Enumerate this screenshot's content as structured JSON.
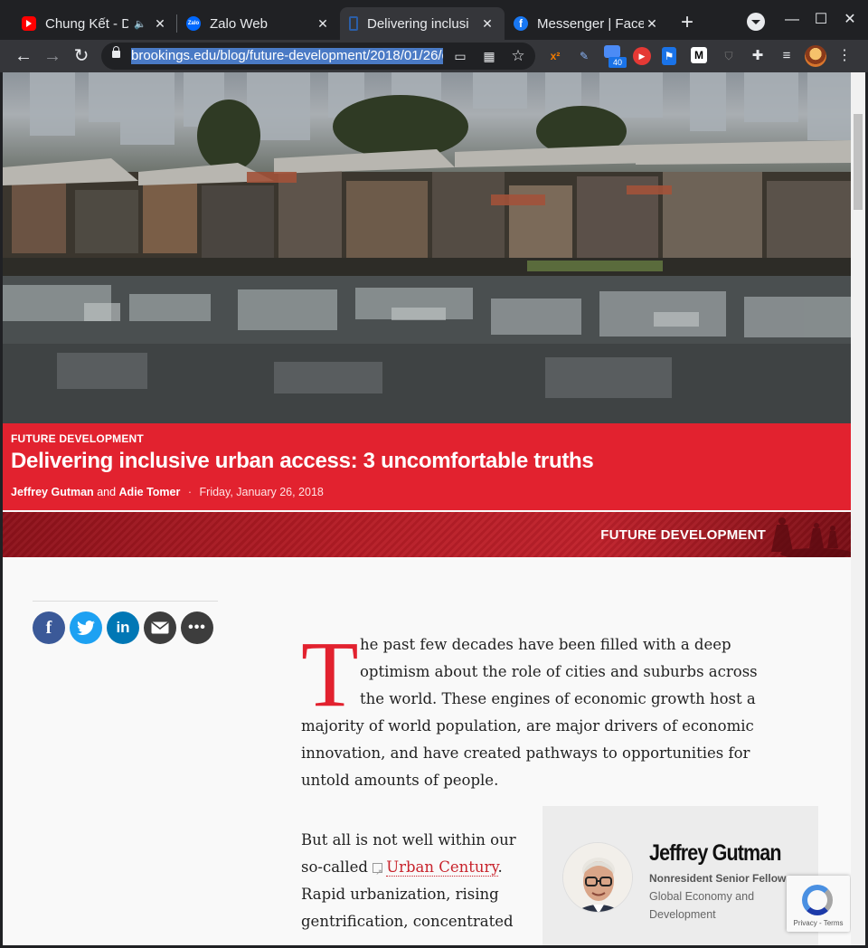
{
  "browser": {
    "tabs": [
      {
        "title": "Chung Kết - D",
        "favicon": "youtube-icon",
        "audio": true
      },
      {
        "title": "Zalo Web",
        "favicon": "zalo-icon"
      },
      {
        "title": "Delivering inclusi",
        "favicon": "brookings-icon",
        "active": true
      },
      {
        "title": "Messenger | Face",
        "favicon": "facebook-icon"
      }
    ],
    "url": "brookings.edu/blog/future-development/2018/01/26/d",
    "extension_badge": "40",
    "extensions": [
      "x²",
      "✎",
      "▶",
      "M"
    ]
  },
  "article": {
    "kicker": "FUTURE DEVELOPMENT",
    "headline": "Delivering inclusive urban access: 3 uncomfortable truths",
    "author1": "Jeffrey Gutman",
    "and": "and",
    "author2": "Adie Tomer",
    "separator": "·",
    "date": "Friday, January 26, 2018",
    "banner_label": "FUTURE DEVELOPMENT",
    "dropcap": "T",
    "p1_lines": [
      "he past few decades have been filled with a deep",
      "optimism about the role of cities and suburbs across",
      "the world. These engines of economic growth host a",
      "majority of world population, are major drivers of economic",
      "innovation, and have created pathways to opportunities for",
      "untold amounts of people."
    ],
    "p2_line1": "But all is not well within our",
    "p2_line2_pre": "so-called ",
    "p2_link": "Urban Century",
    "p2_line2_post": ".",
    "p2_line3": "Rapid urbanization, rising",
    "p2_line4": "gentrification, concentrated"
  },
  "share": {
    "facebook": "f",
    "linkedin": "in",
    "more": "•••"
  },
  "author_card": {
    "name": "Jeffrey Gutman",
    "role": "Nonresident Senior Fellow",
    "dept": "Global Economy and Development"
  },
  "recaptcha": {
    "text": "Privacy - Terms"
  },
  "colors": {
    "brand_red": "#e2222f",
    "link_red": "#c8232c"
  }
}
